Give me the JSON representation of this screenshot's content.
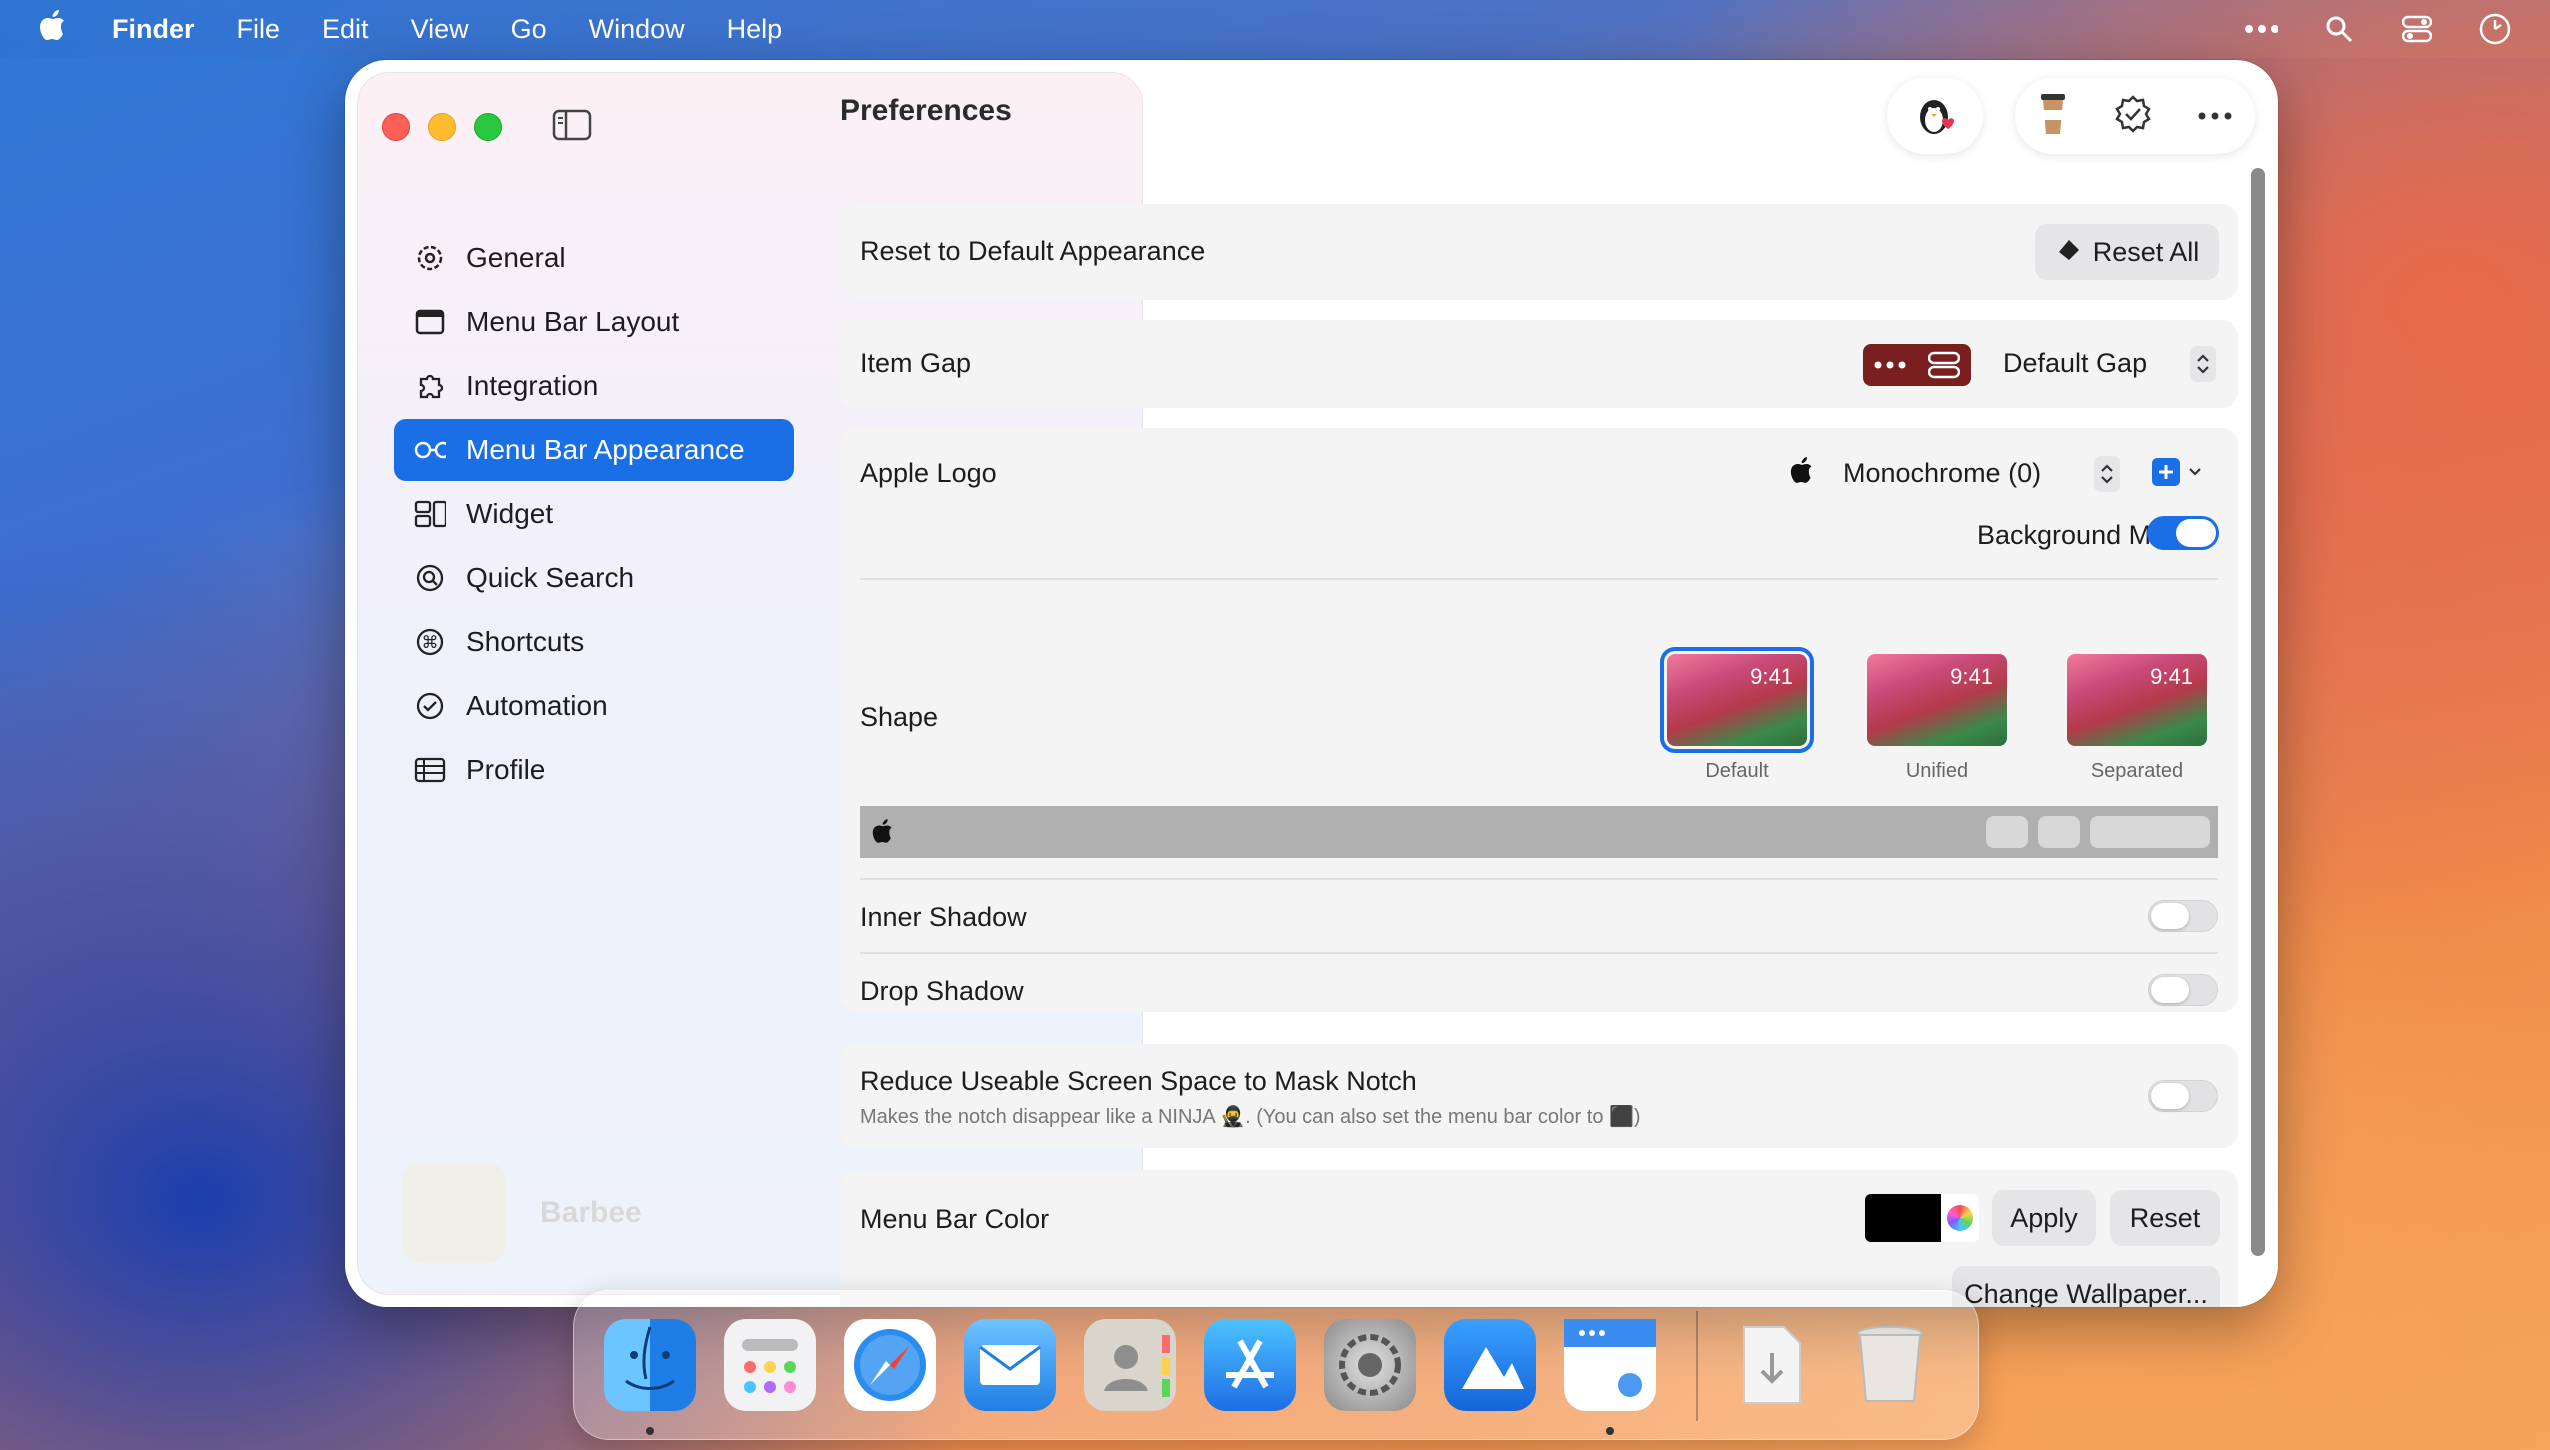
{
  "menubar": {
    "apple": "",
    "app": "Finder",
    "items": [
      "File",
      "Edit",
      "View",
      "Go",
      "Window",
      "Help"
    ]
  },
  "window": {
    "title": "Preferences",
    "nav": [
      {
        "label": "General",
        "icon": "gear-icon"
      },
      {
        "label": "Menu Bar Layout",
        "icon": "menubar-window-icon"
      },
      {
        "label": "Integration",
        "icon": "puzzle-icon"
      },
      {
        "label": "Menu Bar Appearance",
        "icon": "glasses-icon",
        "active": true
      },
      {
        "label": "Widget",
        "icon": "widget-icon"
      },
      {
        "label": "Quick Search",
        "icon": "search-circle-icon"
      },
      {
        "label": "Shortcuts",
        "icon": "command-icon"
      },
      {
        "label": "Automation",
        "icon": "clock-icon"
      },
      {
        "label": "Profile",
        "icon": "profile-card-icon"
      }
    ],
    "brand": "Barbee"
  },
  "settings": {
    "reset": {
      "label": "Reset to Default Appearance",
      "button": "Reset All"
    },
    "item_gap": {
      "label": "Item Gap",
      "value": "Default Gap"
    },
    "apple_logo": {
      "label": "Apple Logo",
      "value": "Monochrome (0)",
      "logo": ""
    },
    "background_mask": {
      "label": "Background Mask",
      "on": true
    },
    "shape": {
      "label": "Shape",
      "time": "9:41",
      "options": [
        "Default",
        "Unified",
        "Separated"
      ],
      "selected": "Default"
    },
    "inner_shadow": {
      "label": "Inner Shadow",
      "on": false
    },
    "drop_shadow": {
      "label": "Drop Shadow",
      "on": false
    },
    "notch": {
      "label": "Reduce Useable Screen Space to Mask Notch",
      "desc": "Makes the notch disappear like a NINJA 🥷. (You can also set the menu bar color to ⬛)",
      "on": false
    },
    "menu_bar_color": {
      "label": "Menu Bar Color",
      "color": "#000000",
      "apply": "Apply",
      "reset": "Reset",
      "wallpaper": "Change Wallpaper..."
    }
  },
  "colors": {
    "accent": "#1a6ee6",
    "gap_badge": "#7a1f1f"
  }
}
